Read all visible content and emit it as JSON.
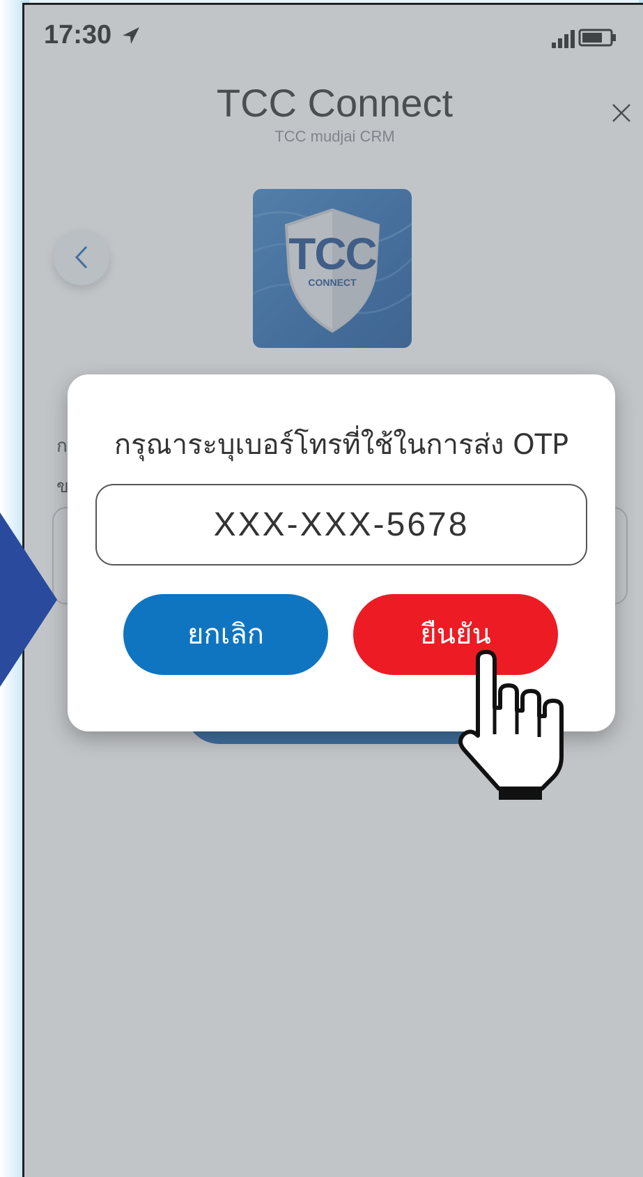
{
  "status_bar": {
    "time": "17:30",
    "location_icon": "location-arrow-icon",
    "signal_icon": "cellular-signal-icon",
    "battery_icon": "battery-icon"
  },
  "header": {
    "title": "TCC Connect",
    "subtitle": "TCC mudjai CRM",
    "close_icon": "close-icon"
  },
  "back_button": {
    "icon": "chevron-left-icon"
  },
  "logo": {
    "main_text": "TCC",
    "sub_text": "CONNECT"
  },
  "background": {
    "line_1": "ก",
    "line_2": "ข"
  },
  "dialog": {
    "prompt": "กรุณาระบุเบอร์โทรที่ใช้ในการส่ง OTP",
    "phone_value": "XXX-XXX-5678",
    "cancel_label": "ยกเลิก",
    "confirm_label": "ยืนยัน"
  },
  "cursor": {
    "icon": "hand-pointer-icon"
  },
  "colors": {
    "cancel": "#0f75c0",
    "confirm": "#ed1b24",
    "frame_accent": "#2a4a9e"
  }
}
